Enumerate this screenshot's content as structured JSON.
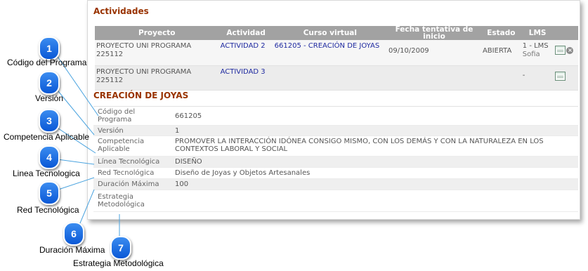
{
  "panel": {
    "title": "Actividades",
    "columns": [
      "Proyecto",
      "Actividad",
      "Curso virtual",
      "Fecha tentativa de inicio",
      "Estado",
      "LMS"
    ],
    "rows": [
      {
        "proyecto": "PROYECTO UNI PROGRAMA 225112",
        "actividad": "ACTIVIDAD 2",
        "curso": "661205 - CREACIÓN DE JOYAS",
        "fecha": "09/10/2009",
        "estado": "ABIERTA",
        "lms": "1 - LMS",
        "lms_sub": "Sofia"
      },
      {
        "proyecto": "PROYECTO UNI PROGRAMA 225112",
        "actividad": "ACTIVIDAD 3",
        "curso": "",
        "fecha": "",
        "estado": "",
        "lms": "-",
        "lms_sub": ""
      }
    ],
    "row_icons": [
      "view-form-icon",
      "close-icon"
    ],
    "x_glyph": "×"
  },
  "detail": {
    "section_title": "CREACIÓN DE JOYAS",
    "fields": [
      {
        "label": "Código del Programa",
        "value": "661205"
      },
      {
        "label": "Versión",
        "value": "1"
      },
      {
        "label": "Competencia Aplicable",
        "value": "PROMOVER LA INTERACCIÓN IDÓNEA CONSIGO MISMO, CON LOS DEMÁS Y CON LA NATURALEZA EN LOS CONTEXTOS LABORAL Y SOCIAL"
      },
      {
        "label": "Línea Tecnológica",
        "value": "DISEÑO"
      },
      {
        "label": "Red Tecnológica",
        "value": "Diseño de Joyas y Objetos Artesanales"
      },
      {
        "label": "Duración Máxima",
        "value": "100"
      },
      {
        "label": "Estrategia Metodológica",
        "value": ""
      }
    ]
  },
  "callouts": [
    {
      "number": "1",
      "label": "Código del Programa"
    },
    {
      "number": "2",
      "label": "Versión"
    },
    {
      "number": "3",
      "label": "Competencia Aplicable"
    },
    {
      "number": "4",
      "label": "Linea Tecnologica"
    },
    {
      "number": "5",
      "label": "Red Tecnológica"
    },
    {
      "number": "6",
      "label": "Duración Máxima"
    },
    {
      "number": "7",
      "label": "Estrategia Metodológica"
    }
  ],
  "colors": {
    "accent": "#993300",
    "header_bg": "#a2a2a2",
    "link": "#1f2aa0",
    "badge": "#1a6fe6",
    "connector": "#4aa3df"
  }
}
